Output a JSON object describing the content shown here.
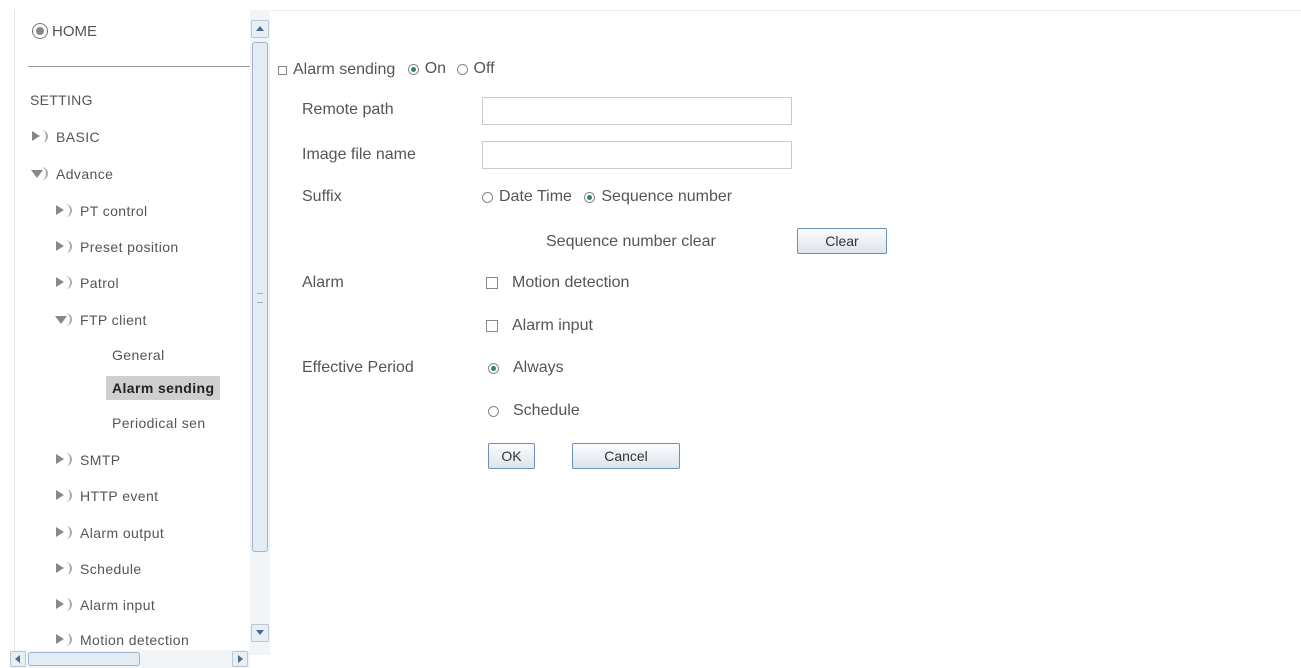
{
  "sidebar": {
    "home_label": "HOME",
    "section_label": "SETTING",
    "items": [
      {
        "label": "BASIC",
        "expanded": false
      },
      {
        "label": "Advance",
        "expanded": true
      },
      {
        "label": "PT control",
        "expanded": false
      },
      {
        "label": "Preset position",
        "expanded": false
      },
      {
        "label": "Patrol",
        "expanded": false
      },
      {
        "label": "FTP client",
        "expanded": true
      },
      {
        "label": "SMTP",
        "expanded": false
      },
      {
        "label": "HTTP event",
        "expanded": false
      },
      {
        "label": "Alarm output",
        "expanded": false
      },
      {
        "label": "Schedule",
        "expanded": false
      },
      {
        "label": "Alarm input",
        "expanded": false
      },
      {
        "label": "Motion detection",
        "expanded": false
      }
    ],
    "ftp_subitems": [
      {
        "label": "General",
        "selected": false
      },
      {
        "label": "Alarm sending",
        "selected": true
      },
      {
        "label": "Periodical sen",
        "selected": false
      }
    ]
  },
  "form": {
    "title": "Alarm sending",
    "on_label": "On",
    "off_label": "Off",
    "alarm_sending_state": "On",
    "remote_path_label": "Remote path",
    "remote_path_value": "",
    "image_file_name_label": "Image file name",
    "image_file_name_value": "",
    "suffix_label": "Suffix",
    "suffix_date_time": "Date Time",
    "suffix_sequence": "Sequence number",
    "suffix_selected": "Sequence number",
    "seq_clear_label": "Sequence number clear",
    "clear_button": "Clear",
    "alarm_label": "Alarm",
    "motion_detection": "Motion detection",
    "motion_detection_checked": false,
    "alarm_input": "Alarm input",
    "alarm_input_checked": false,
    "effective_period_label": "Effective Period",
    "always": "Always",
    "schedule": "Schedule",
    "effective_selected": "Always",
    "ok_button": "OK",
    "cancel_button": "Cancel"
  },
  "colors": {
    "radio_selected": "#2e8b57",
    "selected_nav_bg": "#cfcfcf",
    "button_border": "#6b8fb5",
    "scrollbar_thumb": "#e3ebf3"
  }
}
